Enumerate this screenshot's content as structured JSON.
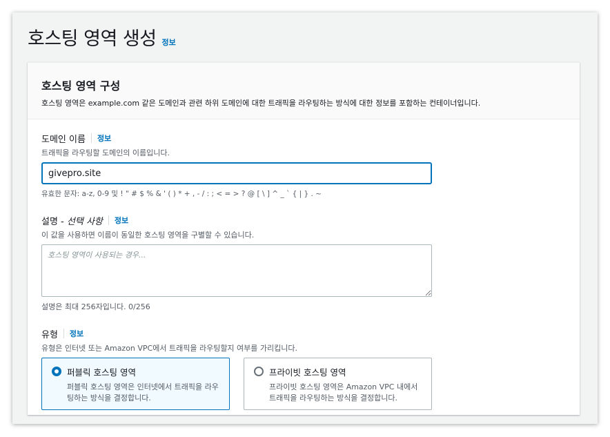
{
  "page": {
    "title": "호스팅 영역 생성",
    "info_label": "정보"
  },
  "panel": {
    "title": "호스팅 영역 구성",
    "description": "호스팅 영역은 example.com 같은 도메인과 관련 하위 도메인에 대한 트래픽을 라우팅하는 방식에 대한 정보를 포함하는 컨테이너입니다."
  },
  "domain_name": {
    "label": "도메인 이름",
    "info_label": "정보",
    "description": "트래픽을 라우팅할 도메인의 이름입니다.",
    "value": "givepro.site",
    "constraint": "유효한 문자: a-z, 0-9 및 ! \" # $ % & ' ( ) * + , - / : ; < = > ? @ [ \\ ] ^ _ ` { | } . ~"
  },
  "description_field": {
    "label_main": "설명 - ",
    "label_optional": "선택 사항",
    "info_label": "정보",
    "description": "이 값을 사용하면 이름이 동일한 호스팅 영역을 구별할 수 있습니다.",
    "placeholder": "호스팅 영역이 사용되는 경우...",
    "value": "",
    "constraint": "설명은 최대 256자입니다. 0/256"
  },
  "type_field": {
    "label": "유형",
    "info_label": "정보",
    "description": "유형은 인터넷 또는 Amazon VPC에서 트래픽을 라우팅할지 여부를 가리킵니다.",
    "options": [
      {
        "title": "퍼블릭 호스팅 영역",
        "description": "퍼블릭 호스팅 영역은 인터넷에서 트래픽을 라우팅하는 방식을 결정합니다.",
        "selected": true
      },
      {
        "title": "프라이빗 호스팅 영역",
        "description": "프라이빗 호스팅 영역은 Amazon VPC 내에서 트래픽을 라우팅하는 방식을 결정합니다.",
        "selected": false
      }
    ]
  },
  "colors": {
    "accent": "#0073bb",
    "selected_tile_bg": "#f1faff",
    "page_bg": "#f2f3f3"
  }
}
